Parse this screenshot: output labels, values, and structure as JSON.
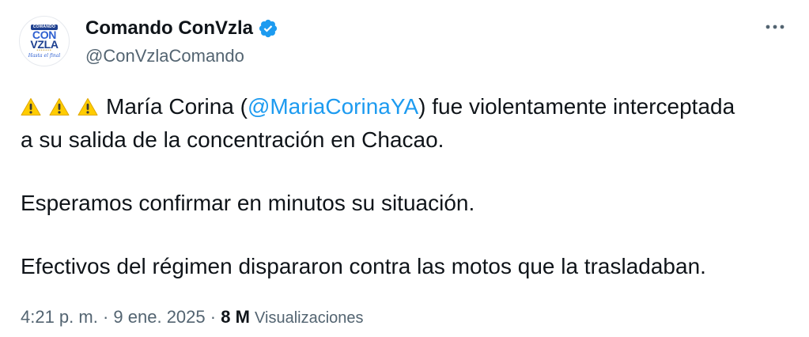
{
  "author": {
    "display_name": "Comando ConVzla",
    "handle": "@ConVzlaComando",
    "verified": true,
    "avatar": {
      "tag": "COMANDO",
      "line1": "CON",
      "line2": "VZLA",
      "script": "Hasta el final"
    }
  },
  "tweet": {
    "line1_before": "María Corina (",
    "mention": "@MariaCorinaYA",
    "line1_after": ") fue violentamente interceptada",
    "line2": "a su salida de la concentración en Chacao.",
    "paragraph2": "Esperamos confirmar en minutos su situación.",
    "paragraph3": "Efectivos del régimen dispararon contra las motos que la trasladaban.",
    "warning_icons": 3
  },
  "meta": {
    "time": "4:21 p. m.",
    "separator": "·",
    "date": "9 ene. 2025",
    "views_count": "8 M",
    "views_label": "Visualizaciones"
  },
  "colors": {
    "text": "#0f1419",
    "secondary": "#536471",
    "link": "#1d9bf0",
    "verified": "#1d9bf0",
    "warning": "#ffcc00"
  },
  "icons": {
    "verified": "verified-badge-icon",
    "more": "more-options-icon",
    "warning": "warning-icon"
  }
}
